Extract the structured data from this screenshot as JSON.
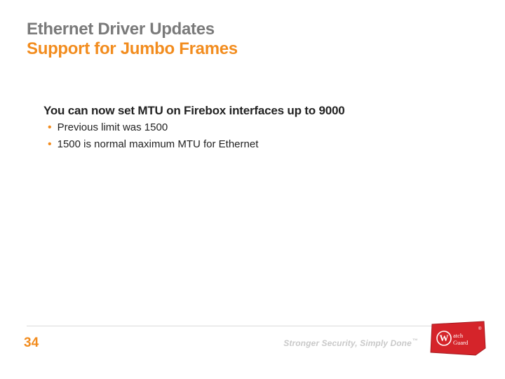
{
  "title": {
    "line1": "Ethernet Driver Updates",
    "line2": "Support for Jumbo Frames"
  },
  "body": {
    "lead": "You can now set MTU on Firebox interfaces up to 9000",
    "bullets": [
      "Previous limit was 1500",
      "1500 is normal maximum MTU for Ethernet"
    ]
  },
  "footer": {
    "page_number": "34",
    "tagline": "Stronger Security, Simply Done",
    "tagline_tm": "™",
    "brand_name": "WatchGuard",
    "brand_mark": "®"
  },
  "colors": {
    "accent": "#f28c1e",
    "logo_red": "#d5242a",
    "title_gray": "#7a7a7a"
  }
}
